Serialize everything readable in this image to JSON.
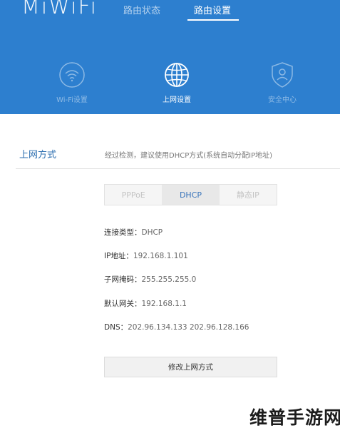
{
  "header": {
    "logo": "MiWiFi",
    "nav": {
      "status_label": "路由状态",
      "settings_label": "路由设置"
    },
    "subnav": {
      "wifi_label": "Wi-Fi设置",
      "network_label": "上网设置",
      "security_label": "安全中心"
    }
  },
  "section": {
    "title": "上网方式",
    "description": "经过检测，建议使用DHCP方式(系统自动分配IP地址)"
  },
  "modes": [
    {
      "label": "PPPoE",
      "active": false
    },
    {
      "label": "DHCP",
      "active": true
    },
    {
      "label": "静态IP",
      "active": false
    }
  ],
  "info": {
    "type_label": "连接类型：",
    "type_value": "DHCP",
    "ip_label": "IP地址：",
    "ip_value": "192.168.1.101",
    "mask_label": "子网掩码：",
    "mask_value": "255.255.255.0",
    "gateway_label": "默认网关：",
    "gateway_value": "192.168.1.1",
    "dns_label": "DNS：",
    "dns_value": "202.96.134.133 202.96.128.166"
  },
  "modify_label": "修改上网方式",
  "watermark": "维普手游网",
  "colors": {
    "header_bg": "#2d7fcf",
    "accent": "#2d6fb0"
  }
}
